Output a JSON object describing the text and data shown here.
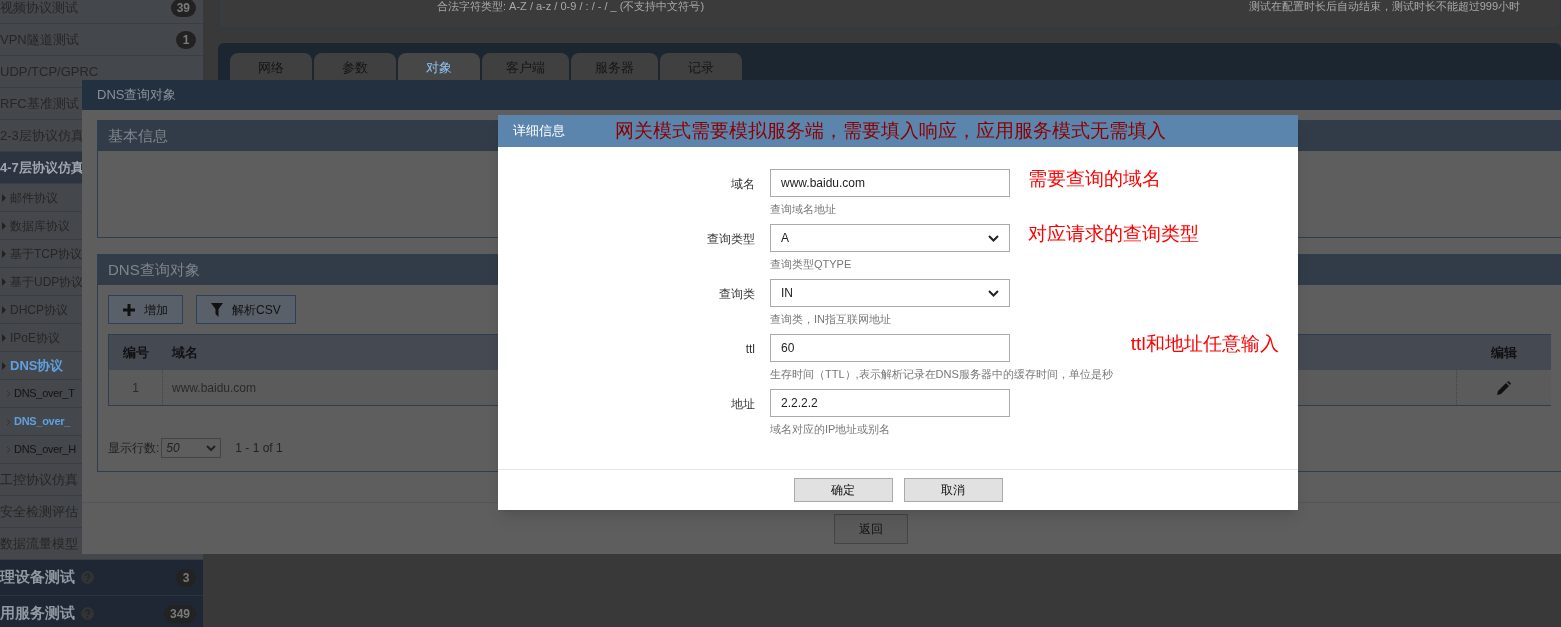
{
  "sidebar": {
    "items": [
      {
        "kind": "group",
        "label": "视频协议测试",
        "badge": "39",
        "selected": false
      },
      {
        "kind": "group",
        "label": "VPN隧道测试",
        "badge": "1",
        "selected": false
      },
      {
        "kind": "group",
        "label": "UDP/TCP/GPRC",
        "selected": false
      },
      {
        "kind": "group",
        "label": "RFC基准测试",
        "selected": false
      },
      {
        "kind": "group",
        "label": "2-3层协议仿真",
        "selected": false
      },
      {
        "kind": "group",
        "label": "4-7层协议仿真",
        "selected": true,
        "children": [
          {
            "label": "邮件协议",
            "selected": false
          },
          {
            "label": "数据库协议",
            "selected": false
          },
          {
            "label": "基于TCP协议",
            "selected": false
          },
          {
            "label": "基于UDP协议",
            "selected": false
          },
          {
            "label": "DHCP协议",
            "selected": false
          },
          {
            "label": "IPoE协议",
            "selected": false
          },
          {
            "label": "DNS协议",
            "selected": true,
            "children": [
              {
                "label": "DNS_over_T",
                "selected": false
              },
              {
                "label": "DNS_over_",
                "selected": true
              },
              {
                "label": "DNS_over_H",
                "selected": false
              }
            ]
          }
        ]
      },
      {
        "kind": "group",
        "label": "工控协议仿真",
        "selected": false
      },
      {
        "kind": "group",
        "label": "安全检测评估",
        "selected": false
      },
      {
        "kind": "group",
        "label": "数据流量模型",
        "selected": false
      },
      {
        "kind": "category",
        "label": "理设备测试",
        "badge": "3",
        "selected": false
      },
      {
        "kind": "category",
        "label": "用服务测试",
        "badge": "349",
        "selected": false
      }
    ]
  },
  "page": {
    "hint_left": "合法字符类型: A-Z / a-z / 0-9 / : / - / _ (不支持中文符号)",
    "hint_right": "测试在配置时长后自动结束，测试时长不能超过999小时",
    "tabs": [
      {
        "label": "网络",
        "selected": false
      },
      {
        "label": "参数",
        "selected": false
      },
      {
        "label": "对象",
        "selected": true
      },
      {
        "label": "客户端",
        "selected": false
      },
      {
        "label": "服务器",
        "selected": false
      },
      {
        "label": "记录",
        "selected": false
      }
    ]
  },
  "object_dialog": {
    "title": "DNS查询对象",
    "basic_info": {
      "title": "基本信息"
    },
    "objects": {
      "title": "DNS查询对象",
      "buttons": [
        "增加",
        "解析CSV"
      ],
      "columns": [
        "编号",
        "域名",
        "编辑"
      ],
      "rows": [
        {
          "number": "1",
          "domain": "www.baidu.com"
        }
      ],
      "pager": {
        "label": "显示行数:",
        "page_size": "50",
        "range": "1 - 1 of 1"
      }
    },
    "back_button": "返回"
  },
  "detail_dialog": {
    "title": "详细信息",
    "note": "网关模式需要模拟服务端，需要填入响应，应用服务模式无需填入",
    "fields": [
      {
        "kind": "text",
        "label": "域名",
        "value": "www.baidu.com",
        "help": "查询域名地址",
        "note": "需要查询的域名"
      },
      {
        "kind": "select",
        "label": "查询类型",
        "value": "A",
        "help": "查询类型QTYPE",
        "note": "对应请求的查询类型"
      },
      {
        "kind": "select",
        "label": "查询类",
        "value": "IN",
        "help": "查询类，IN指互联网地址"
      },
      {
        "kind": "text",
        "label": "ttl",
        "value": "60",
        "help": "生存时间（TTL）,表示解析记录在DNS服务器中的缓存时间，单位是秒",
        "note": "ttl和地址任意输入"
      },
      {
        "kind": "text",
        "label": "地址",
        "value": "2.2.2.2",
        "help": "域名对应的IP地址或别名"
      }
    ],
    "buttons": [
      "确定",
      "取消"
    ]
  }
}
